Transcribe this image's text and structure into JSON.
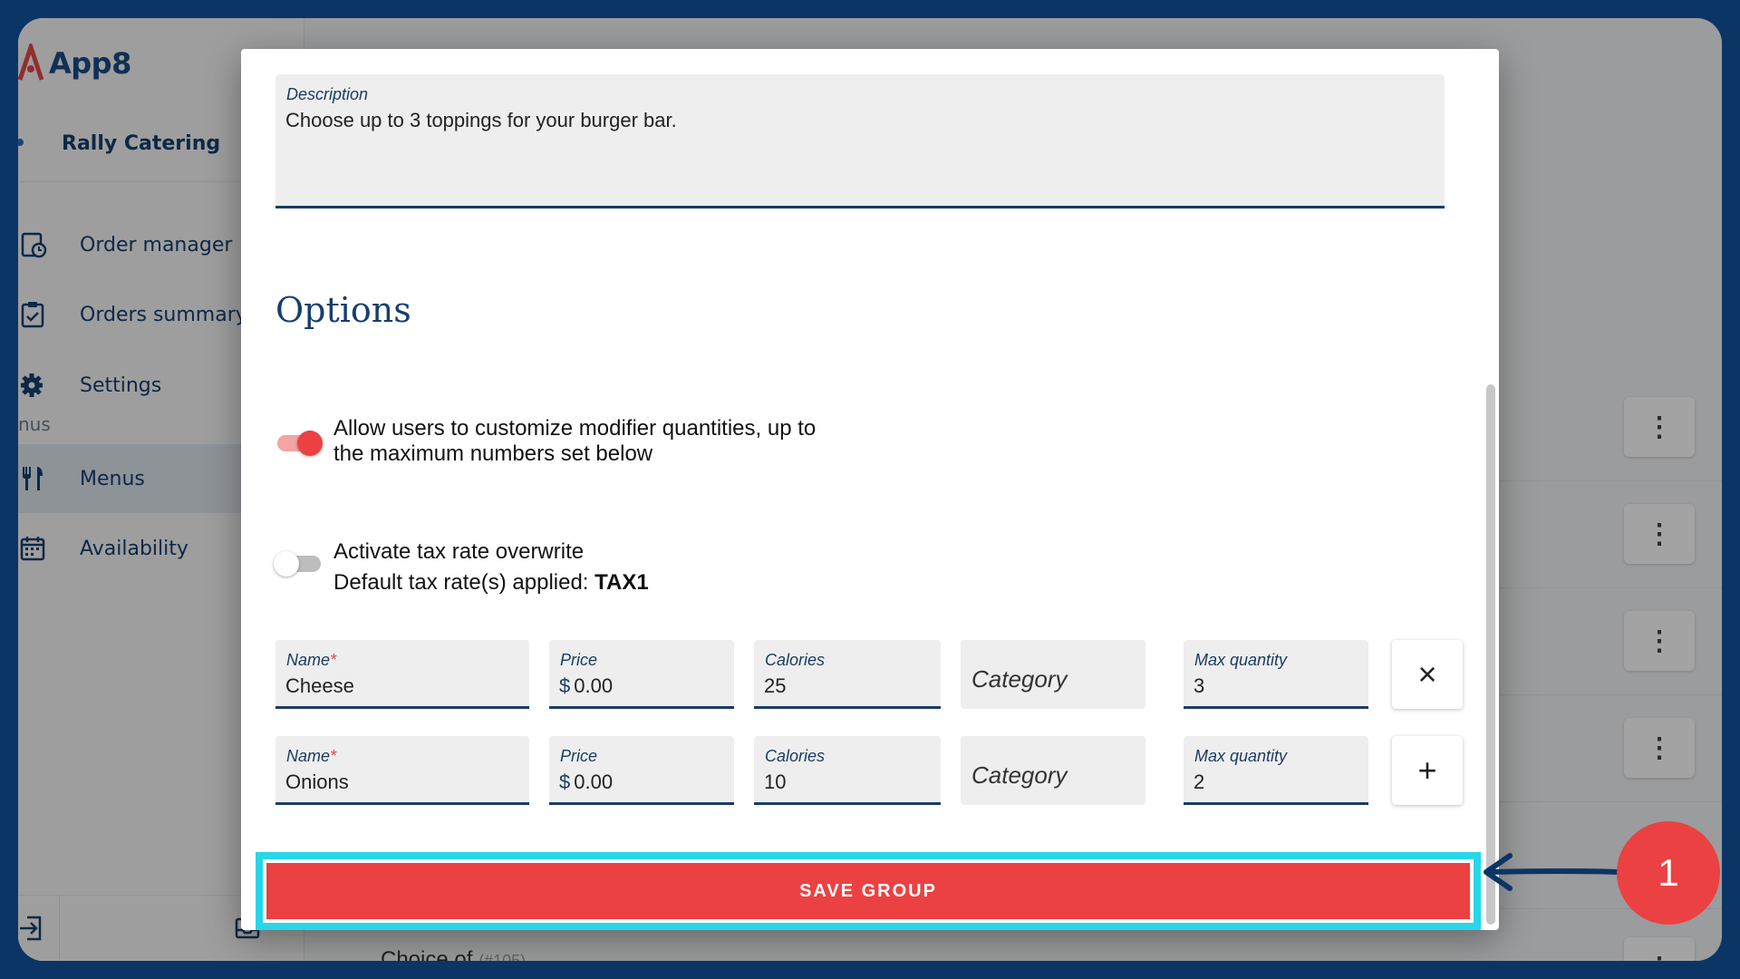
{
  "app": {
    "name": "App8",
    "organization": "Rally Catering"
  },
  "sidebar": {
    "items": [
      {
        "label": "Order manager",
        "icon": "clipboard-clock-icon"
      },
      {
        "label": "Orders summary",
        "icon": "clipboard-check-icon"
      },
      {
        "label": "Settings",
        "icon": "gear-icon"
      },
      {
        "label": "Menus",
        "icon": "utensils-icon"
      },
      {
        "label": "Availability",
        "icon": "calendar-icon"
      }
    ],
    "section_label": "nus",
    "active_item": "Menus"
  },
  "background": {
    "row_text": "Choice of",
    "row_id": "(#105)"
  },
  "modal": {
    "description": {
      "label": "Description",
      "value": "Choose up to 3 toppings for your burger bar."
    },
    "options_heading": "Options",
    "toggles": [
      {
        "label_line1": "Allow users to customize modifier quantities, up to",
        "label_line2": "the maximum numbers set below",
        "on": true
      },
      {
        "label_line1": "Activate tax rate overwrite",
        "label_line2_prefix": "Default tax rate(s) applied: ",
        "label_line2_bold": "TAX1",
        "on": false
      }
    ],
    "modifiers": [
      {
        "name_label": "Name",
        "name": "Cheese",
        "price_label": "Price",
        "currency": "$",
        "price": "0.00",
        "calories_label": "Calories",
        "calories": "25",
        "category_placeholder": "Category",
        "max_label": "Max quantity",
        "max": "3",
        "action": "×"
      },
      {
        "name_label": "Name",
        "name": "Onions",
        "price_label": "Price",
        "currency": "$",
        "price": "0.00",
        "calories_label": "Calories",
        "calories": "10",
        "category_placeholder": "Category",
        "max_label": "Max quantity",
        "max": "2",
        "action": "+"
      }
    ],
    "required_mark": "*",
    "save_label": "SAVE GROUP"
  },
  "annotation": {
    "step": "1"
  },
  "colors": {
    "accent_red": "#ec4142",
    "navy": "#153f70",
    "highlight_cyan": "#27d6e8",
    "frame": "#0b3565"
  }
}
